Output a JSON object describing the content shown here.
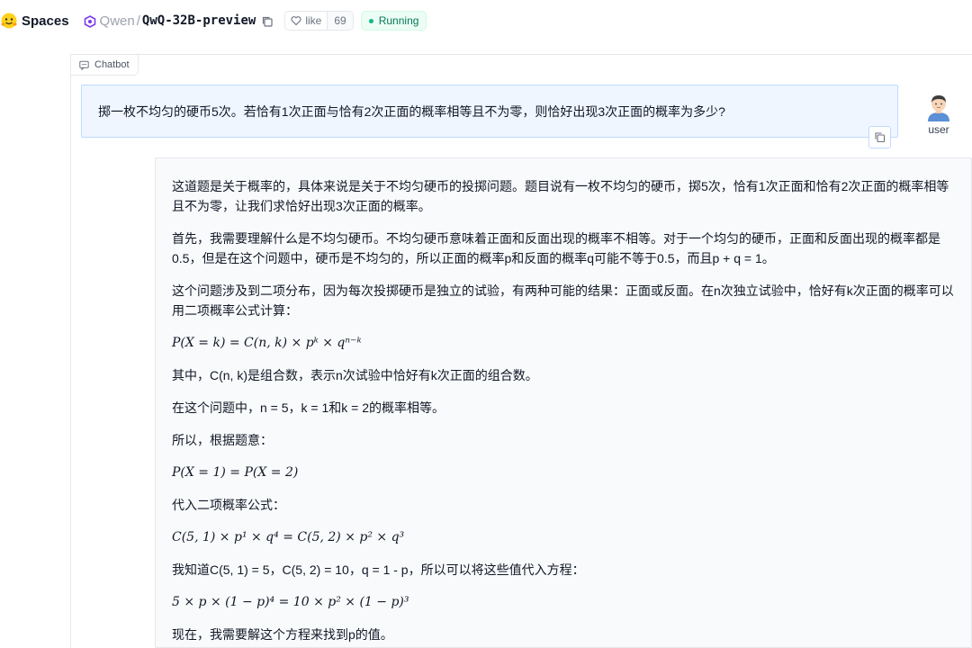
{
  "header": {
    "spaces_label": "Spaces",
    "org": "Qwen",
    "slash": "/",
    "repo": "QwQ-32B-preview",
    "like_label": "like",
    "like_count": "69",
    "status": "Running"
  },
  "chatbot": {
    "label": "Chatbot",
    "user_message": "掷一枚不均匀的硬币5次。若恰有1次正面与恰有2次正面的概率相等且不为零，则恰好出现3次正面的概率为多少?",
    "user_label": "user",
    "bot_lines": [
      {
        "type": "text",
        "text": "这道题是关于概率的，具体来说是关于不均匀硬币的投掷问题。题目说有一枚不均匀的硬币，掷5次，恰有1次正面和恰有2次正面的概率相等且不为零，让我们求恰好出现3次正面的概率。"
      },
      {
        "type": "text",
        "text": "首先，我需要理解什么是不均匀硬币。不均匀硬币意味着正面和反面出现的概率不相等。对于一个均匀的硬币，正面和反面出现的概率都是0.5，但是在这个问题中，硬币是不均匀的，所以正面的概率p和反面的概率q可能不等于0.5，而且p + q = 1。"
      },
      {
        "type": "text",
        "text": "这个问题涉及到二项分布，因为每次投掷硬币是独立的试验，有两种可能的结果：正面或反面。在n次独立试验中，恰好有k次正面的概率可以用二项概率公式计算："
      },
      {
        "type": "math",
        "text": "P(X = k) = C(n, k) × pᵏ × qⁿ⁻ᵏ"
      },
      {
        "type": "text",
        "text": "其中，C(n, k)是组合数，表示n次试验中恰好有k次正面的组合数。"
      },
      {
        "type": "text",
        "text": "在这个问题中，n = 5，k = 1和k = 2的概率相等。"
      },
      {
        "type": "text",
        "text": "所以，根据题意："
      },
      {
        "type": "math",
        "text": "P(X = 1) = P(X = 2)"
      },
      {
        "type": "text",
        "text": "代入二项概率公式："
      },
      {
        "type": "math",
        "text": "C(5, 1) × p¹ × q⁴ = C(5, 2) × p² × q³"
      },
      {
        "type": "text",
        "text": "我知道C(5, 1) = 5，C(5, 2) = 10，q = 1 - p，所以可以将这些值代入方程："
      },
      {
        "type": "math",
        "text": "5 × p × (1 − p)⁴ = 10 × p² × (1 − p)³"
      },
      {
        "type": "text",
        "text": "现在，我需要解这个方程来找到p的值。"
      }
    ]
  },
  "colors": {
    "user_bg": "#eff6ff",
    "user_border": "#bfdbfe",
    "bot_bg": "#f9fafb",
    "status_green": "#10b981"
  },
  "icons": [
    "hugging-face-logo-icon",
    "qwen-logo-icon",
    "copy-icon",
    "heart-icon",
    "chat-icon",
    "user-avatar-icon"
  ]
}
